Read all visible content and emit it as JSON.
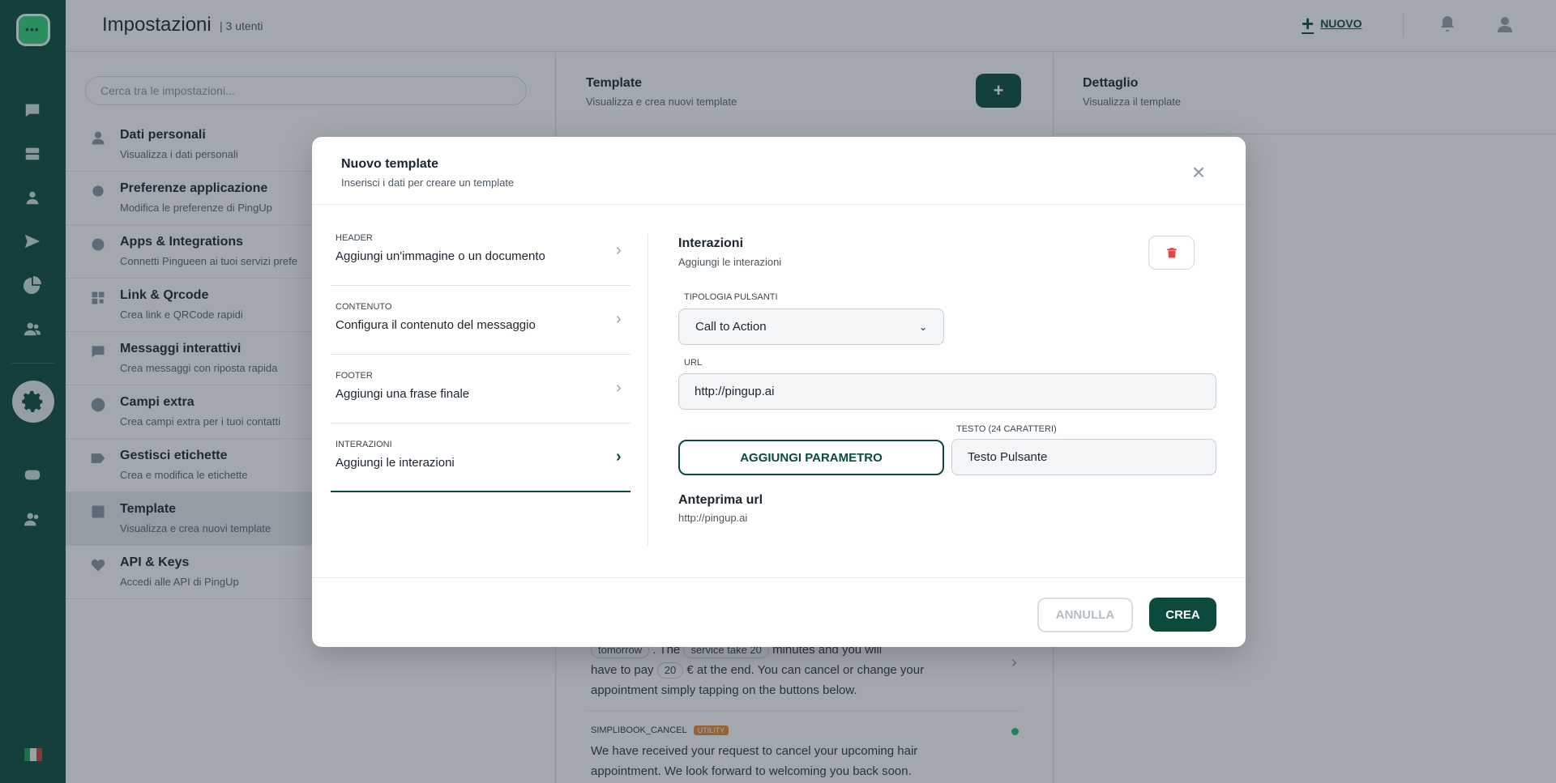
{
  "header": {
    "title": "Impostazioni",
    "user_count": "| 3 utenti",
    "new_button": "NUOVO"
  },
  "settings": {
    "search_placeholder": "Cerca tra le impostazioni...",
    "items": [
      {
        "title": "Dati personali",
        "subtitle": "Visualizza i dati personali",
        "icon": "user-icon"
      },
      {
        "title": "Preferenze applicazione",
        "subtitle": "Modifica le preferenze di PingUp",
        "icon": "gear-icon"
      },
      {
        "title": "Apps & Integrations",
        "subtitle": "Connetti Pingueen ai tuoi servizi prefe",
        "icon": "integration-icon"
      },
      {
        "title": "Link & Qrcode",
        "subtitle": "Crea link e QRCode rapidi",
        "icon": "qrcode-icon"
      },
      {
        "title": "Messaggi interattivi",
        "subtitle": "Crea messaggi con riposta rapida",
        "icon": "chat-icon"
      },
      {
        "title": "Campi extra",
        "subtitle": "Crea campi extra per i tuoi contatti",
        "icon": "info-icon"
      },
      {
        "title": "Gestisci etichette",
        "subtitle": "Crea e modifica le etichette",
        "icon": "tag-icon"
      },
      {
        "title": "Template",
        "subtitle": "Visualizza e crea nuovi template",
        "icon": "template-icon"
      },
      {
        "title": "API & Keys",
        "subtitle": "Accedi alle API di PingUp",
        "icon": "heart-icon"
      }
    ]
  },
  "template_panel": {
    "title": "Template",
    "subtitle": "Visualizza e crea nuovi template",
    "add_label": "+",
    "item1_chip_a": "tomorrow",
    "item1_text_a": ". The",
    "item1_chip_b": "service take 20",
    "item1_text_b": "minutes and you will",
    "item1_text_c": "have to pay",
    "item1_chip_c": "20",
    "item1_text_d": "€ at the end. You can cancel or change your",
    "item1_text_e": "appointment simply tapping on the buttons below.",
    "item2_name": "SIMPLIBOOK_CANCEL",
    "item2_badge": "UTILITY",
    "item2_text": "We have received your request to cancel your upcoming hair appointment. We look forward to welcoming you back soon."
  },
  "detail_panel": {
    "title": "Dettaglio",
    "subtitle": "Visualizza il template"
  },
  "modal": {
    "title": "Nuovo template",
    "subtitle": "Inserisci i dati per creare un template",
    "steps": [
      {
        "key": "HEADER",
        "value": "Aggiungi un'immagine o un documento"
      },
      {
        "key": "CONTENUTO",
        "value": "Configura il contenuto del messaggio"
      },
      {
        "key": "FOOTER",
        "value": "Aggiungi una frase finale"
      },
      {
        "key": "INTERAZIONI",
        "value": "Aggiungi le interazioni"
      }
    ],
    "section_title": "Interazioni",
    "section_subtitle": "Aggiungi le interazioni",
    "button_type_label": "TIPOLOGIA PULSANTI",
    "button_type_value": "Call to Action",
    "url_label": "URL",
    "url_value": "http://pingup.ai",
    "add_param_button": "AGGIUNGI PARAMETRO",
    "text_label": "TESTO (24 CARATTERI)",
    "text_value": "Testo Pulsante",
    "preview_title": "Anteprima url",
    "preview_url": "http://pingup.ai",
    "cancel_button": "ANNULLA",
    "create_button": "CREA"
  },
  "colors": {
    "brand": "#0b4a3c",
    "danger": "#e04848",
    "utility_badge": "#e38b3a",
    "status_dot": "#2ab673"
  }
}
